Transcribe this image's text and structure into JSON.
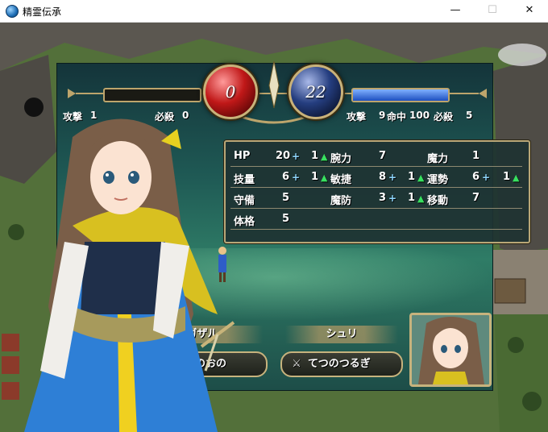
{
  "window": {
    "title": "精霊伝承",
    "minimize": "—",
    "maximize": "☐",
    "close": "✕"
  },
  "battle": {
    "left": {
      "hp": "0",
      "attack_label": "攻撃",
      "attack": "1",
      "crit_label": "必殺",
      "crit": "0"
    },
    "right": {
      "hp": "22",
      "attack_label": "攻撃",
      "attack": "9",
      "hit_label": "命中",
      "hit": "100",
      "crit_label": "必殺",
      "crit": "5"
    },
    "right_gauge_fraction": 1.0
  },
  "stats": {
    "hp": {
      "label": "HP",
      "value": "20",
      "bonus": "1"
    },
    "skill": {
      "label": "技量",
      "value": "6",
      "bonus": "1"
    },
    "defense": {
      "label": "守備",
      "value": "5"
    },
    "build": {
      "label": "体格",
      "value": "5"
    },
    "strength": {
      "label": "腕力",
      "value": "7"
    },
    "speed": {
      "label": "敏捷",
      "value": "8",
      "bonus": "1"
    },
    "resistance": {
      "label": "魔防",
      "value": "3",
      "bonus": "1"
    },
    "magic": {
      "label": "魔力",
      "value": "1"
    },
    "luck": {
      "label": "運勢",
      "value": "6",
      "bonus": "1"
    },
    "move": {
      "label": "移動",
      "value": "7"
    },
    "plus_symbol": "+",
    "up_symbol": "▲"
  },
  "names": {
    "left": "ガザル",
    "right": "シュリ"
  },
  "weapons": {
    "left": "ぼうのおの",
    "right": "てつのつるぎ"
  },
  "colors": {
    "panel": "#1f5a55",
    "gold_frame": "#bda56c",
    "hp_red": "#c01818",
    "hp_blue": "#253e80",
    "bonus": "#38e060"
  }
}
